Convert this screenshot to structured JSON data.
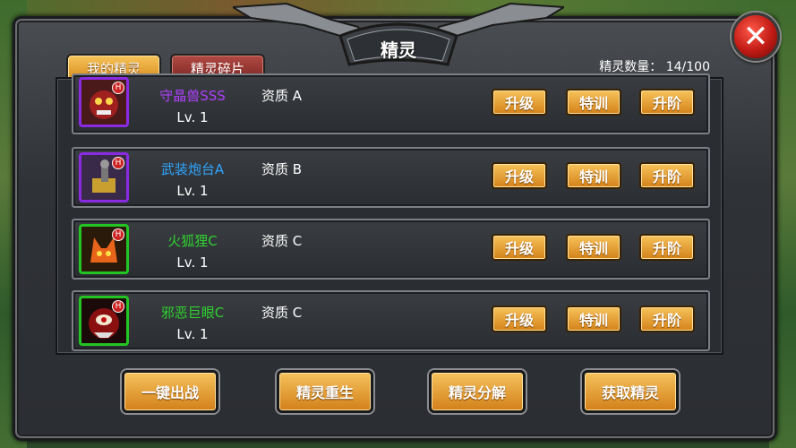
{
  "header": {
    "title": "精灵",
    "count_label": "精灵数量：",
    "count_value": "14/100"
  },
  "tabs": [
    {
      "label": "我的精灵",
      "active": true
    },
    {
      "label": "精灵碎片",
      "active": false
    }
  ],
  "close_icon": "close-icon",
  "sprites": [
    {
      "name": "守晶兽SSS",
      "name_color": "#b040ff",
      "frame_color": "#8a2be2",
      "level": "Lv. 1",
      "quality": "资质 A",
      "badge": "H"
    },
    {
      "name": "武装炮台A",
      "name_color": "#2ea6ff",
      "frame_color": "#8a2be2",
      "level": "Lv. 1",
      "quality": "资质 B",
      "badge": "H"
    },
    {
      "name": "火狐狸C",
      "name_color": "#2fd12f",
      "frame_color": "#22c522",
      "level": "Lv. 1",
      "quality": "资质 C",
      "badge": "H"
    },
    {
      "name": "邪恶巨眼C",
      "name_color": "#2fd12f",
      "frame_color": "#22c522",
      "level": "Lv. 1",
      "quality": "资质 C",
      "badge": "H"
    }
  ],
  "row_buttons": {
    "upgrade": "升级",
    "train": "特训",
    "advance": "升阶"
  },
  "bottom_buttons": [
    {
      "label": "一键出战"
    },
    {
      "label": "精灵重生"
    },
    {
      "label": "精灵分解"
    },
    {
      "label": "获取精灵"
    }
  ],
  "colors": {
    "accent": "#e39a2a",
    "tab_inactive": "#8e302a",
    "close": "#d22a1e"
  }
}
